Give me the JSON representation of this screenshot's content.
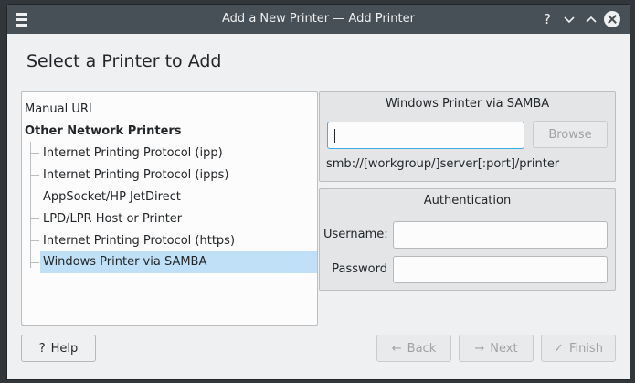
{
  "window": {
    "title": "Add a New Printer — Add Printer",
    "help_glyph": "?",
    "minimize_glyph": "⌄",
    "maximize_glyph": "⌃"
  },
  "page": {
    "heading": "Select a Printer to Add"
  },
  "printer_list": {
    "items": [
      {
        "label": "Manual URI",
        "level": 0,
        "bold": false,
        "selected": false
      },
      {
        "label": "Other Network Printers",
        "level": 0,
        "bold": true,
        "selected": false
      },
      {
        "label": "Internet Printing Protocol (ipp)",
        "level": 1,
        "bold": false,
        "selected": false
      },
      {
        "label": "Internet Printing Protocol (ipps)",
        "level": 1,
        "bold": false,
        "selected": false
      },
      {
        "label": "AppSocket/HP JetDirect",
        "level": 1,
        "bold": false,
        "selected": false
      },
      {
        "label": "LPD/LPR Host or Printer",
        "level": 1,
        "bold": false,
        "selected": false
      },
      {
        "label": "Internet Printing Protocol (https)",
        "level": 1,
        "bold": false,
        "selected": false
      },
      {
        "label": "Windows Printer via SAMBA",
        "level": 1,
        "bold": false,
        "selected": true
      }
    ]
  },
  "samba": {
    "title": "Windows Printer via SAMBA",
    "uri_value": "",
    "browse_label": "Browse",
    "hint": "smb://[workgroup/]server[:port]/printer"
  },
  "auth": {
    "title": "Authentication",
    "username_label": "Username:",
    "username_value": "",
    "password_label": "Password",
    "password_value": ""
  },
  "buttons": {
    "help_label": "Help",
    "help_icon": "?",
    "back_label": "Back",
    "back_icon": "←",
    "next_label": "Next",
    "next_icon": "→",
    "finish_label": "Finish",
    "finish_icon": "✓"
  },
  "colors": {
    "selection": "#bfe0f6",
    "focus": "#3daee9",
    "titlebar": "#475057"
  }
}
